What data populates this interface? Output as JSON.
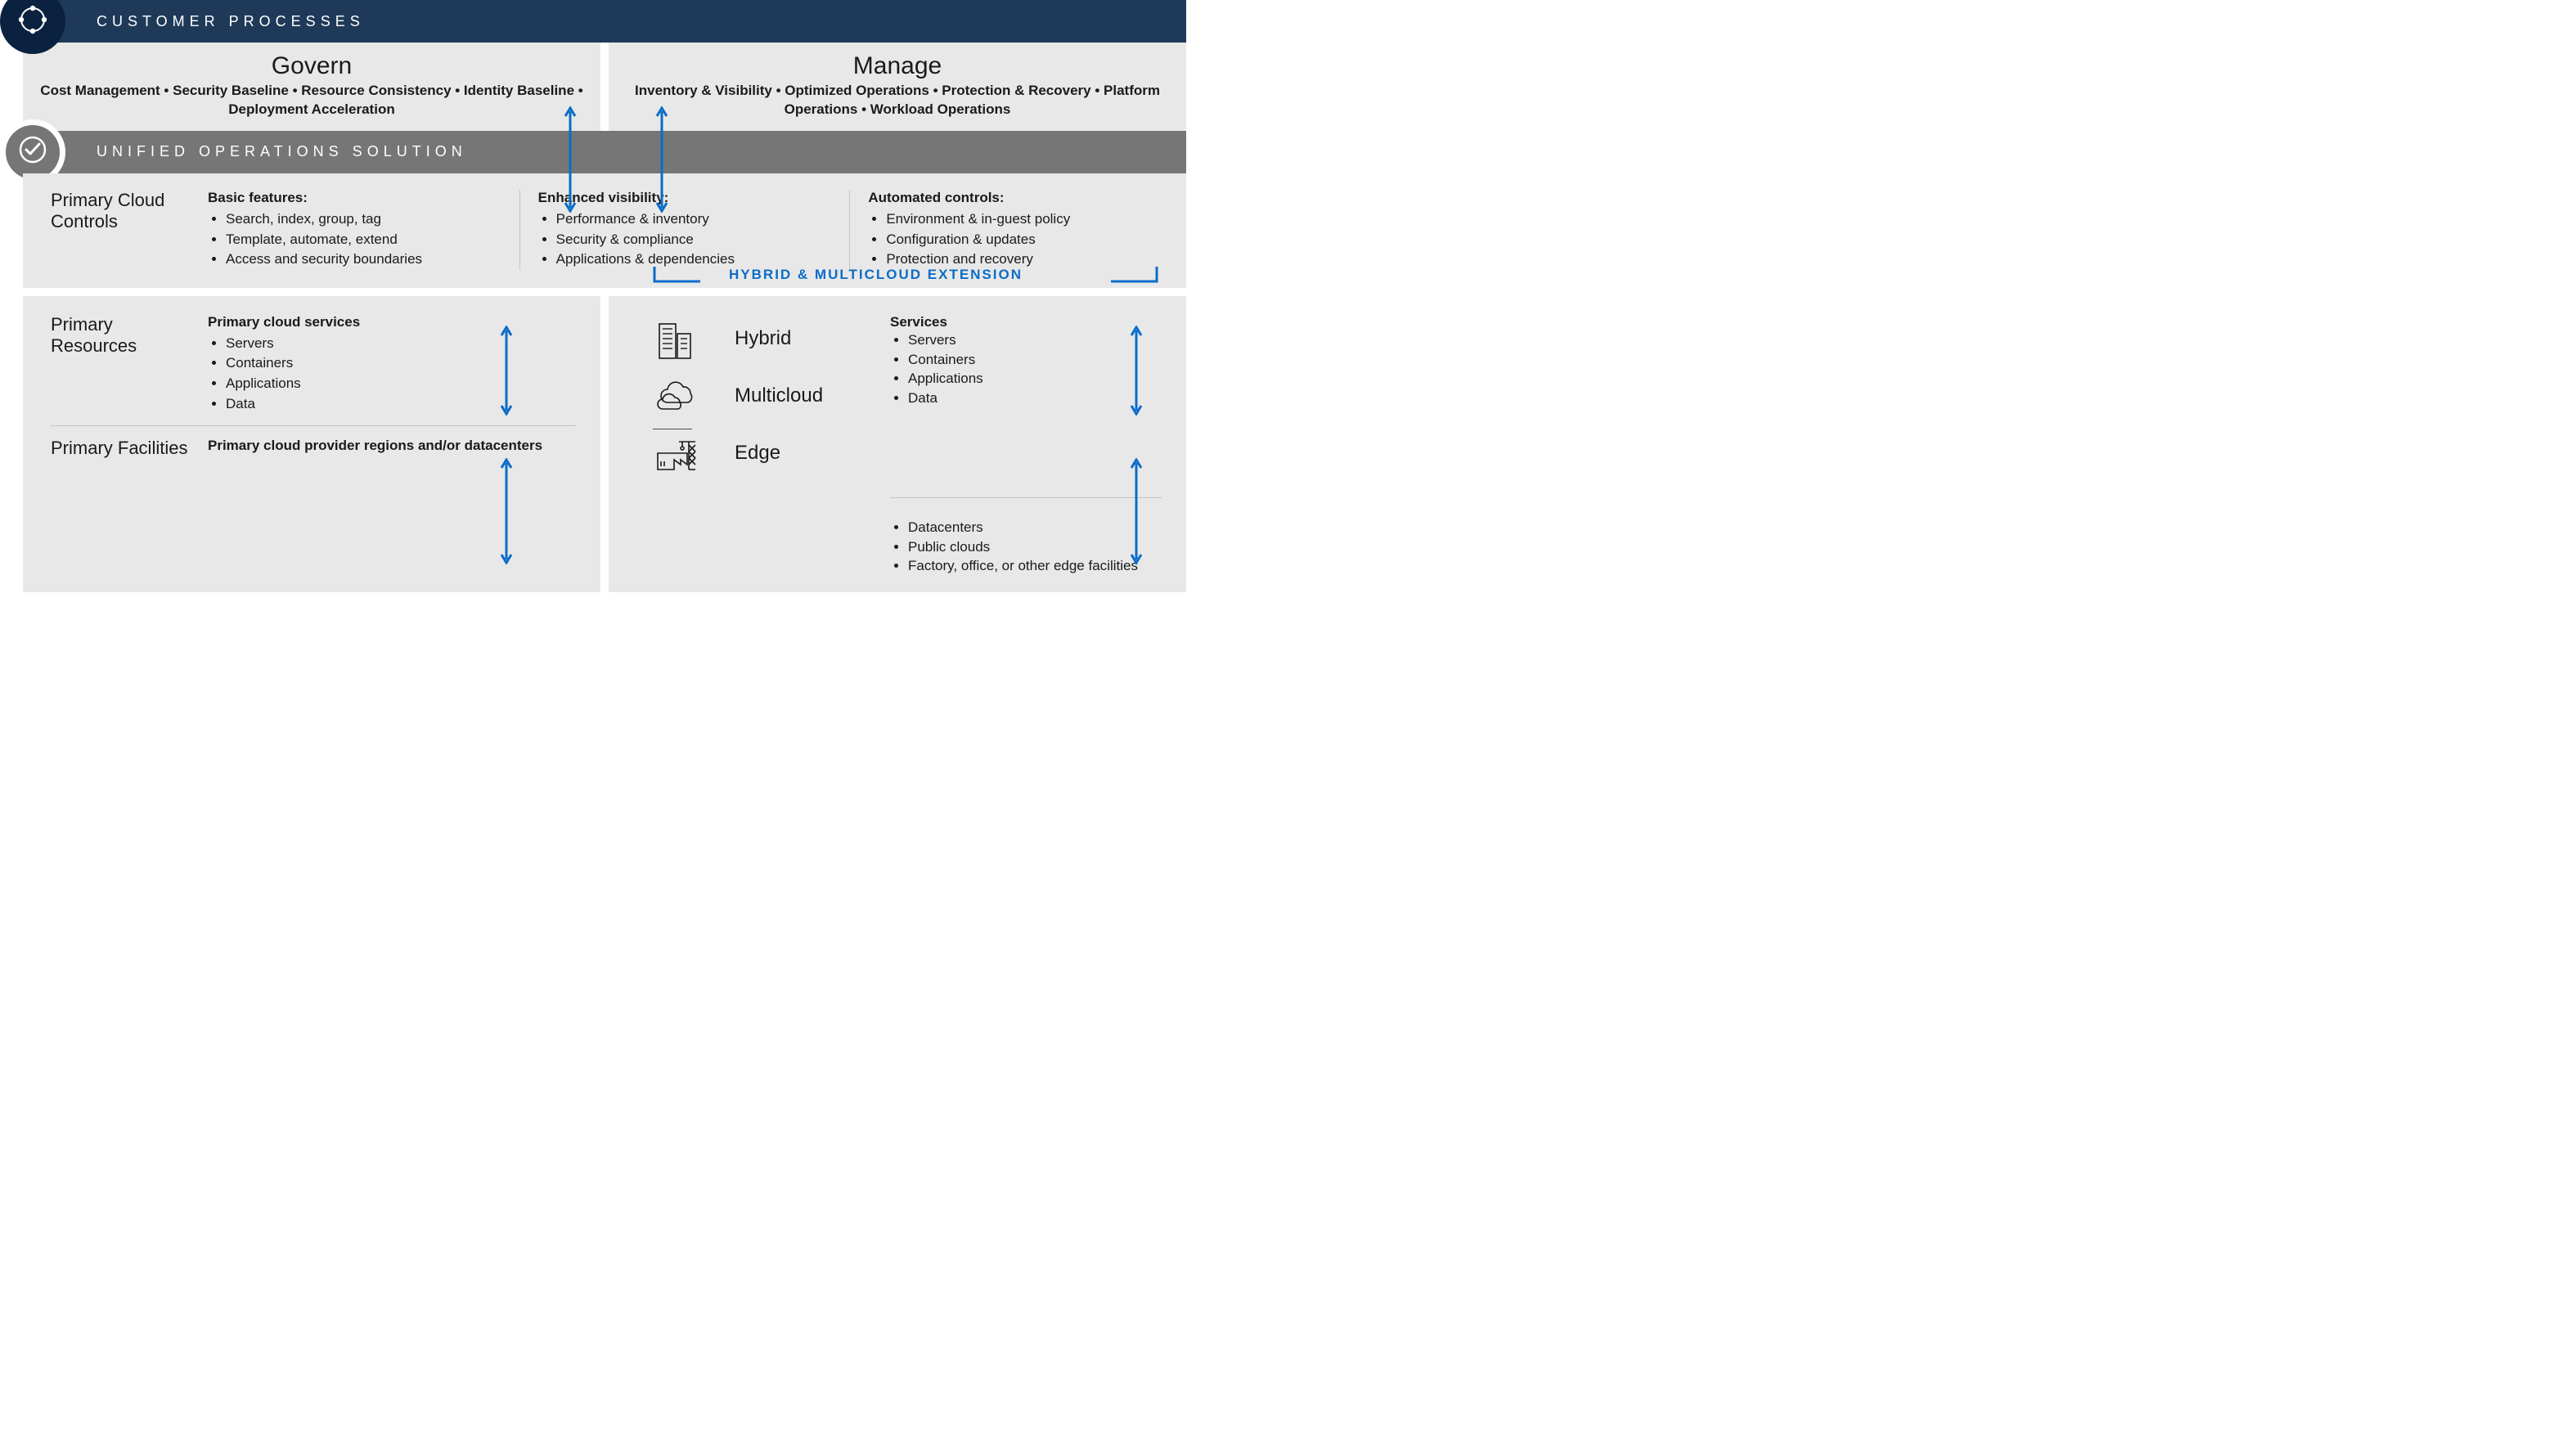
{
  "header1": {
    "title": "CUSTOMER PROCESSES"
  },
  "header2": {
    "title": "UNIFIED OPERATIONS SOLUTION"
  },
  "govern": {
    "title": "Govern",
    "sub": "Cost Management • Security Baseline • Resource Consistency • Identity Baseline • Deployment Acceleration"
  },
  "manage": {
    "title": "Manage",
    "sub": "Inventory & Visibility • Optimized Operations • Protection & Recovery • Platform Operations • Workload Operations"
  },
  "pcc": {
    "label": "Primary Cloud Controls",
    "basic": {
      "title": "Basic features:",
      "items": [
        "Search, index, group, tag",
        "Template, automate, extend",
        "Access and security boundaries"
      ]
    },
    "enhanced": {
      "title": "Enhanced visibility:",
      "items": [
        "Performance & inventory",
        "Security & compliance",
        "Applications & dependencies"
      ]
    },
    "automated": {
      "title": "Automated controls:",
      "items": [
        "Environment & in-guest policy",
        "Configuration & updates",
        "Protection and recovery"
      ]
    },
    "hme": "HYBRID & MULTICLOUD EXTENSION"
  },
  "primaryResources": {
    "label": "Primary Resources",
    "title": "Primary cloud services",
    "items": [
      "Servers",
      "Containers",
      "Applications",
      "Data"
    ]
  },
  "primaryFacilities": {
    "label": "Primary Facilities",
    "text": "Primary cloud provider regions and/or datacenters"
  },
  "hybrid": {
    "label": "Hybrid"
  },
  "multicloud": {
    "label": "Multicloud"
  },
  "edge": {
    "label": "Edge"
  },
  "services": {
    "title": "Services",
    "items": [
      "Servers",
      "Containers",
      "Applications",
      "Data"
    ]
  },
  "facilities2": {
    "items": [
      "Datacenters",
      "Public clouds",
      "Factory, office, or other edge facilities"
    ]
  }
}
